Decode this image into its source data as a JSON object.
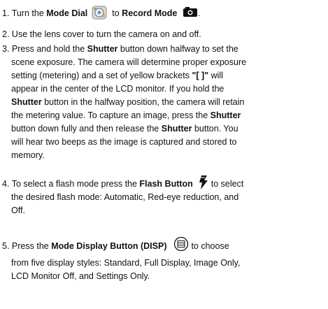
{
  "steps": [
    {
      "num": "1.",
      "t1": "Turn the ",
      "b1": "Mode Dial",
      "t2": " to ",
      "b2": "Record Mode",
      "icons": [
        "mode-dial-icon",
        "record-mode-icon"
      ]
    },
    {
      "num": "2.",
      "text": "Use the lens cover to turn the camera on and off."
    },
    {
      "num": "3.",
      "l1a": "Press and hold the ",
      "l1b": "Shutter",
      "l1c": " button down halfway to set the",
      "l2": "scene exposure. The camera will determine proper exposure",
      "l3a": "setting (metering) and a set of yellow brackets ",
      "l3b": "\"[   ]\"",
      "l3c": " will",
      "l4": "appear in the center of the LCD monitor. If you hold the",
      "l5a": "Shutter",
      "l5b": " button in the halfway position, the camera will retain",
      "l6a": "the metering value. To capture an image, press the ",
      "l6b": "Shutter",
      "l7a": "button down fully and then release the ",
      "l7b": "Shutter",
      "l7c": " button. You",
      "l8": "will hear two beeps as the image is captured and stored to",
      "l9": "memory."
    },
    {
      "num": "4.",
      "l1a": "To select a flash mode press the ",
      "l1b": "Flash Button",
      "l1c": " to select",
      "l2": "the desired flash mode: Automatic, Red-eye reduction, and",
      "l3": "Off.",
      "icon": "flash-button-icon"
    },
    {
      "num": "5.",
      "l1a": "Press the ",
      "l1b": "Mode Display Button (DISP)",
      "l1c": " to choose",
      "l2": "from five display styles: Standard, Full Display, Image Only,",
      "l3": "LCD Monitor Off, and Settings Only.",
      "icon": "disp-button-icon"
    }
  ]
}
